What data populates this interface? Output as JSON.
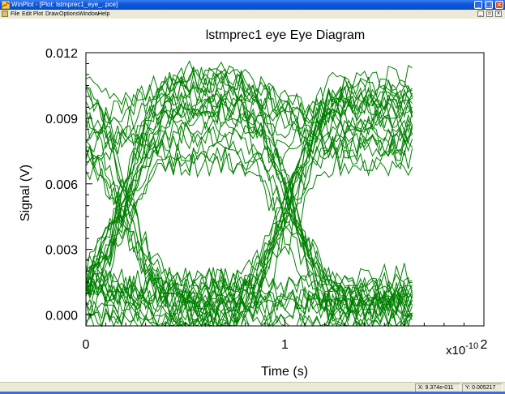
{
  "window": {
    "title": "WinPlot - [Plot: lstmprec1_eye_..pce]",
    "minimize_glyph": "_",
    "maximize_glyph": "□",
    "close_glyph": "×",
    "icons": {
      "app": "chart-icon"
    }
  },
  "menu": {
    "items": [
      "File",
      "Edit",
      "Plot",
      "Draw",
      "Options",
      "Window",
      "Help"
    ],
    "mdi_minimize": "_",
    "mdi_restore": "▫",
    "mdi_close": "×"
  },
  "status": {
    "x": "X: 9.374e-011",
    "y": "Y: 0.005217"
  },
  "colors": {
    "titlebar": "#0a56d8",
    "trace": "#008000",
    "axis": "#000000",
    "background": "#ffffff"
  },
  "chart_data": {
    "type": "line",
    "title": "lstmprec1 eye  Eye Diagram",
    "xlabel": "Time (s)",
    "ylabel": "Signal (V)",
    "x_multiplier": "x10",
    "x_multiplier_exp": "-10",
    "xlim": [
      0,
      2
    ],
    "ylim": [
      -0.0005,
      0.012
    ],
    "x_ticks": [
      "0",
      "1",
      "2"
    ],
    "y_ticks": [
      "0.000",
      "0.003",
      "0.006",
      "0.009",
      "0.012"
    ],
    "x_tick_values": [
      0,
      1,
      2
    ],
    "y_tick_values": [
      0,
      0.003,
      0.006,
      0.009,
      0.012
    ],
    "grid": false,
    "legend": "none",
    "unit_interval": 0.82,
    "x_end": 1.65,
    "eye_period": 0.82,
    "eye_crossing_x": [
      0.2,
      1.02
    ],
    "eye_open_center_x": [
      0.61,
      1.43
    ],
    "level_high_band": [
      0.0068,
      0.0112
    ],
    "level_mid_band": [
      0.0005,
      0.0018
    ],
    "level_low_band": [
      -0.0005,
      0.0008
    ],
    "crossing_level": 0.0068,
    "trace_count": 46,
    "noise_amplitude": 0.0006
  }
}
